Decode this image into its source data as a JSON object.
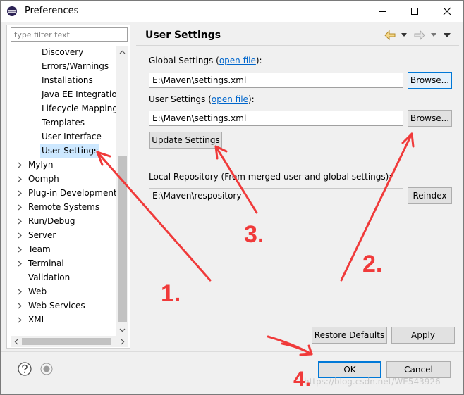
{
  "window": {
    "title": "Preferences",
    "minimize_label": "Minimize",
    "maximize_label": "Maximize",
    "close_label": "Close"
  },
  "filter": {
    "placeholder": "type filter text"
  },
  "tree": {
    "children": [
      {
        "label": "Discovery"
      },
      {
        "label": "Errors/Warnings"
      },
      {
        "label": "Installations"
      },
      {
        "label": "Java EE Integration"
      },
      {
        "label": "Lifecycle Mappings"
      },
      {
        "label": "Templates"
      },
      {
        "label": "User Interface"
      },
      {
        "label": "User Settings",
        "selected": true
      }
    ],
    "roots": [
      {
        "label": "Mylyn",
        "expandable": true
      },
      {
        "label": "Oomph",
        "expandable": true
      },
      {
        "label": "Plug-in Development",
        "expandable": true
      },
      {
        "label": "Remote Systems",
        "expandable": true
      },
      {
        "label": "Run/Debug",
        "expandable": true
      },
      {
        "label": "Server",
        "expandable": true
      },
      {
        "label": "Team",
        "expandable": true
      },
      {
        "label": "Terminal",
        "expandable": true
      },
      {
        "label": "Validation",
        "expandable": false
      },
      {
        "label": "Web",
        "expandable": true
      },
      {
        "label": "Web Services",
        "expandable": true
      },
      {
        "label": "XML",
        "expandable": true
      }
    ]
  },
  "page": {
    "title": "User Settings",
    "global_label": "Global Settings (",
    "global_link": "open file",
    "global_suffix": "):",
    "global_value": "E:\\Maven\\settings.xml",
    "user_label": "User Settings (",
    "user_link": "open file",
    "user_suffix": "):",
    "user_value": "E:\\Maven\\settings.xml",
    "browse_label": "Browse...",
    "update_label": "Update Settings",
    "local_repo_label": "Local Repository (From merged user and global settings):",
    "local_repo_value": "E:\\Maven\\respository",
    "reindex_label": "Reindex",
    "restore_label": "Restore Defaults",
    "apply_label": "Apply"
  },
  "footer": {
    "ok_label": "OK",
    "cancel_label": "Cancel"
  },
  "annotations": [
    "1.",
    "2.",
    "3.",
    "4."
  ],
  "watermark": "https://blog.csdn.net/WE543926",
  "colors": {
    "annotation": "#f03a3a",
    "link": "#0066cc",
    "selection": "#cde8ff",
    "accent": "#0078d7"
  }
}
